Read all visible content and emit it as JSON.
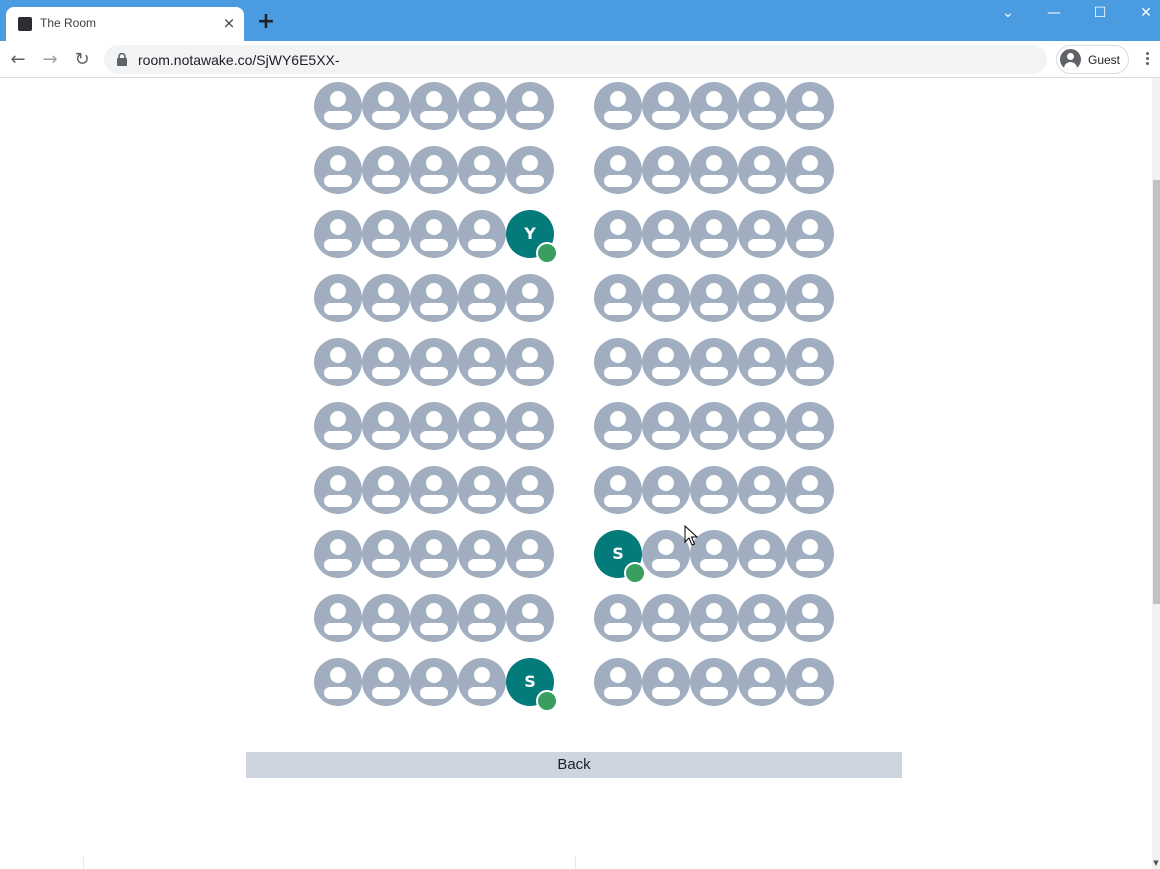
{
  "browser": {
    "tab_title": "The Room",
    "tab_close": "×",
    "new_tab": "+",
    "url": "room.notawake.co/SjWY6E5XX-",
    "profile_label": "Guest",
    "window_controls": {
      "dropdown": "⌄",
      "minimize": "—",
      "maximize": "☐",
      "close": "✕"
    },
    "nav": {
      "back": "←",
      "forward": "→",
      "reload": "↻"
    }
  },
  "room": {
    "left_block": {
      "rows": [
        [
          "",
          "",
          "",
          "",
          ""
        ],
        [
          "",
          "",
          "",
          "",
          ""
        ],
        [
          "",
          "",
          "",
          "",
          "Y"
        ],
        [
          "",
          "",
          "",
          "",
          ""
        ],
        [
          "",
          "",
          "",
          "",
          ""
        ],
        [
          "",
          "",
          "",
          "",
          ""
        ],
        [
          "",
          "",
          "",
          "",
          ""
        ],
        [
          "",
          "",
          "",
          "",
          ""
        ],
        [
          "",
          "",
          "",
          "",
          ""
        ],
        [
          "",
          "",
          "",
          "",
          "S"
        ]
      ]
    },
    "right_block": {
      "rows": [
        [
          "",
          "",
          "",
          "",
          ""
        ],
        [
          "",
          "",
          "",
          "",
          ""
        ],
        [
          "",
          "",
          "",
          "",
          ""
        ],
        [
          "",
          "",
          "",
          "",
          ""
        ],
        [
          "",
          "",
          "",
          "",
          ""
        ],
        [
          "",
          "",
          "",
          "",
          ""
        ],
        [
          "",
          "",
          "",
          "",
          ""
        ],
        [
          "S",
          "",
          "",
          "",
          ""
        ],
        [
          "",
          "",
          "",
          "",
          ""
        ],
        [
          "",
          "",
          "",
          "",
          ""
        ]
      ]
    },
    "colors": {
      "empty_seat": "#a0aec0",
      "occupied_seat": "#047b7b",
      "online_status": "#3a9e5f"
    }
  },
  "back_button": {
    "label": "Back"
  }
}
